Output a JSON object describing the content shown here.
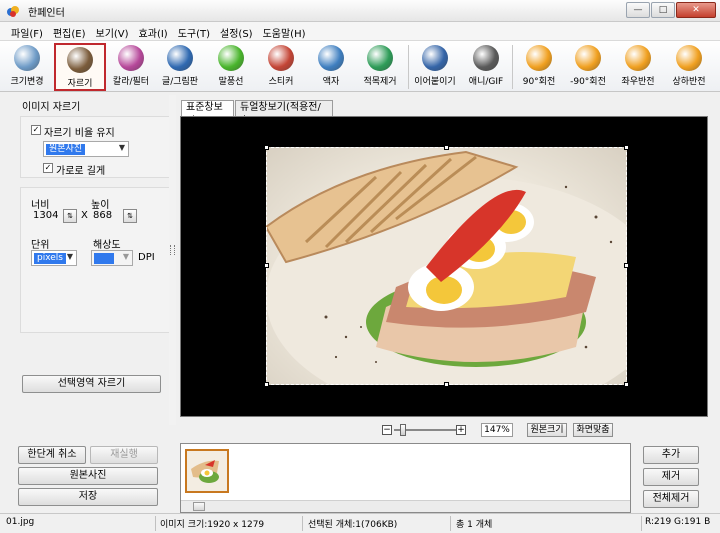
{
  "window": {
    "title": "한페인터"
  },
  "menu": [
    "파일(F)",
    "편집(E)",
    "보기(V)",
    "효과(I)",
    "도구(T)",
    "설정(S)",
    "도움말(H)"
  ],
  "toolbar": {
    "tools": [
      {
        "label": "크기변경",
        "icon": "resize-icon",
        "color": "#6e9bc7"
      },
      {
        "label": "자르기",
        "icon": "crop-icon",
        "color": "#7b5c3b"
      },
      {
        "label": "칼라/필터",
        "icon": "color-filter-icon",
        "color": "#b6489a"
      },
      {
        "label": "글/그림판",
        "icon": "text-draw-icon",
        "color": "#2f69b1"
      },
      {
        "label": "말풍선",
        "icon": "speech-bubble-icon",
        "color": "#49b52c"
      },
      {
        "label": "스티커",
        "icon": "sticker-icon",
        "color": "#c44536"
      },
      {
        "label": "액자",
        "icon": "frame-icon",
        "color": "#3f7fc0"
      },
      {
        "label": "적목제거",
        "icon": "red-eye-icon",
        "color": "#2e9c58"
      },
      {
        "label": "이어붙이기",
        "icon": "merge-icon",
        "color": "#3565a8"
      },
      {
        "label": "애니/GIF",
        "icon": "animation-gif-icon",
        "color": "#5a5a5a"
      },
      {
        "label": "90°회전",
        "icon": "rotate-right-icon",
        "color": "#f0a020"
      },
      {
        "label": "-90°회전",
        "icon": "rotate-left-icon",
        "color": "#f0a020"
      },
      {
        "label": "좌우반전",
        "icon": "flip-horizontal-icon",
        "color": "#f0a020"
      },
      {
        "label": "상하반전",
        "icon": "flip-vertical-icon",
        "color": "#f0a020"
      }
    ],
    "selected": "자르기",
    "selected_color": "#c0282d"
  },
  "crop_panel": {
    "title": "이미지 자르기",
    "keep_ratio_label": "자르기 비율 유지",
    "keep_ratio_checked": true,
    "ratio_select": "원본사진",
    "landscape_label": "가로로 길게",
    "landscape_checked": true,
    "width_label": "너비",
    "width_value": "1304",
    "height_label": "높이",
    "height_value": "868",
    "times": "X",
    "unit_label": "단위",
    "unit_value": "pixels",
    "resolution_label": "해상도",
    "resolution_value": "",
    "dpi": "DPI",
    "crop_button": "선택영역 자르기"
  },
  "left_buttons": {
    "undo": "한단계 취소",
    "redo": "재실행",
    "original": "원본사진",
    "save": "저장"
  },
  "view_tabs": [
    "표준창보기",
    "듀얼창보기(적용전/후)"
  ],
  "zoom": {
    "minus": "−",
    "plus": "+",
    "value": "147%",
    "level_fraction": 0.15,
    "original_size": "원본크기",
    "fit_screen": "화면맞춤"
  },
  "right_buttons": {
    "add": "추가",
    "remove": "제거",
    "remove_all": "전체제거"
  },
  "status": {
    "filename": "01.jpg",
    "image_size": "이미지 크기:1920 x 1279",
    "selected": "선택된 개체:1(706KB)",
    "total": "총 1 개체",
    "color": "R:219 G:191 B"
  }
}
